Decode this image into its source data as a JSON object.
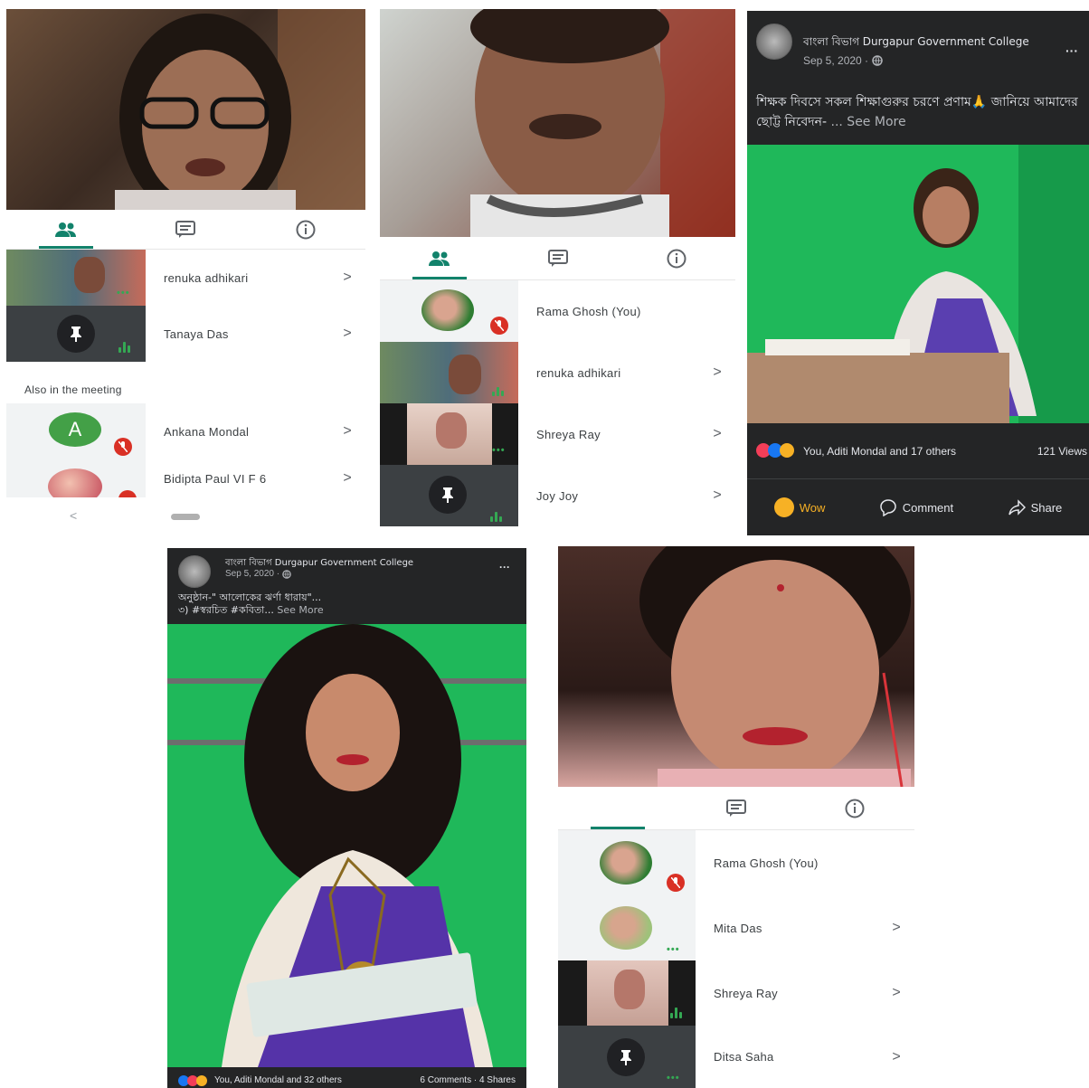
{
  "panel1": {
    "participants": [
      {
        "name": "renuka adhikari"
      },
      {
        "name": "Tanaya Das"
      }
    ],
    "section_label": "Also in the meeting",
    "others": [
      {
        "name": "Ankana Mondal",
        "initial": "A"
      },
      {
        "name": "Bidipta Paul VI F 6"
      }
    ],
    "nav_back": "<"
  },
  "panel2": {
    "participants": [
      {
        "name": "Rama Ghosh (You)"
      },
      {
        "name": "renuka adhikari"
      },
      {
        "name": "Shreya Ray"
      },
      {
        "name": "Joy Joy"
      }
    ]
  },
  "panel3": {
    "page_name": "বাংলা বিভাগ Durgapur Government College",
    "date": "Sep 5, 2020 ·",
    "caption": "শিক্ষক দিবসে সকল শিক্ষাগুরুর চরণে প্রণাম🙏 জানিয়ে আমাদের ছোট্ট নিবেদন-",
    "see_more": "... See More",
    "reactions": "You, Aditi Mondal and 17 others",
    "views": "121 Views",
    "actions": {
      "wow": "Wow",
      "comment": "Comment",
      "share": "Share"
    },
    "more": "···"
  },
  "panel4": {
    "page_name": "বাংলা বিভাগ Durgapur Government College",
    "date": "Sep 5, 2020 ·",
    "caption_line1": "অনুষ্ঠান-\" আলোকের ঝর্ণা ধারায়\"...",
    "caption_line2": "৩) #স্বরচিত #কবিতা...",
    "see_more": "See More",
    "reactions": "You, Aditi Mondal and 32 others",
    "stats": "6 Comments · 4 Shares",
    "more": "···"
  },
  "panel5": {
    "participants": [
      {
        "name": "Rama Ghosh (You)"
      },
      {
        "name": "Mita Das"
      },
      {
        "name": "Shreya Ray"
      },
      {
        "name": "Ditsa Saha"
      }
    ]
  },
  "colors": {
    "meet_green": "#12826b",
    "fb_dark": "#242526",
    "screen_green": "#1fb85a",
    "mic_red": "#d93025"
  },
  "icons": [
    "people-icon",
    "chat-icon",
    "info-icon",
    "chevron-right-icon",
    "pin-icon",
    "mic-off-icon",
    "more-icon",
    "globe-icon",
    "comment-icon",
    "share-icon",
    "wow-icon"
  ]
}
